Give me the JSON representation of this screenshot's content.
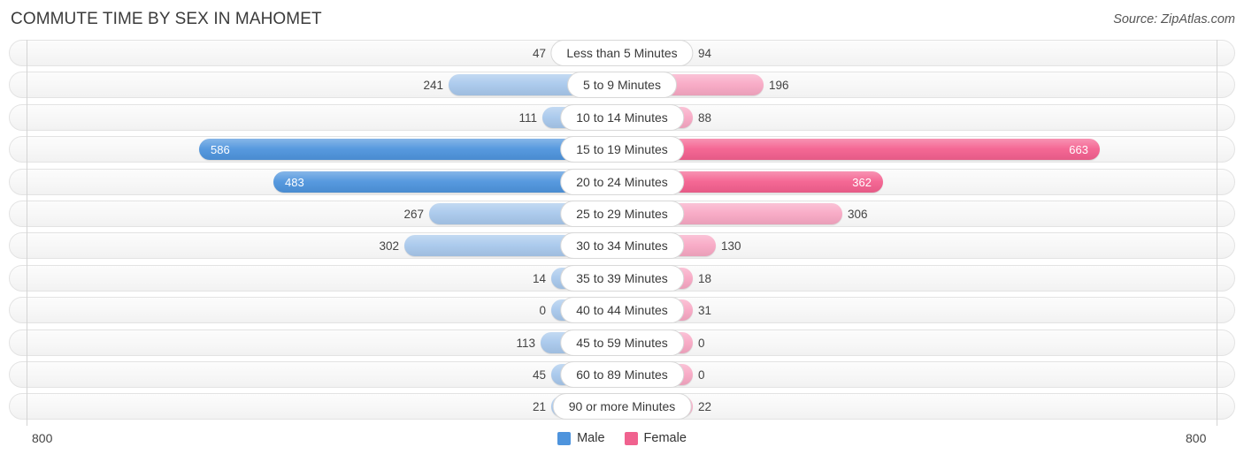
{
  "header": {
    "title": "COMMUTE TIME BY SEX IN MAHOMET",
    "source": "Source: ZipAtlas.com"
  },
  "legend": {
    "items": [
      {
        "label": "Male",
        "color": "#4e94dd"
      },
      {
        "label": "Female",
        "color": "#f0628f"
      }
    ]
  },
  "axis": {
    "left_label": "800",
    "right_label": "800",
    "max": 800
  },
  "colors": {
    "male_strong": "#4e94dd",
    "male_light": "#a8c8ec",
    "female_strong": "#f4608f",
    "female_light": "#f8a8c4",
    "row_track": "#f7f7f7",
    "row_border": "#e3e3e3",
    "gridline": "#d4d4d4"
  },
  "chart_data": {
    "type": "bar",
    "title": "COMMUTE TIME BY SEX IN MAHOMET",
    "subtitle": "Source: ZipAtlas.com",
    "orientation": "horizontal-diverging",
    "xlabel": "",
    "ylabel": "",
    "xlim": [
      800,
      800
    ],
    "grid": true,
    "legend_position": "bottom-center",
    "categories": [
      "Less than 5 Minutes",
      "5 to 9 Minutes",
      "10 to 14 Minutes",
      "15 to 19 Minutes",
      "20 to 24 Minutes",
      "25 to 29 Minutes",
      "30 to 34 Minutes",
      "35 to 39 Minutes",
      "40 to 44 Minutes",
      "45 to 59 Minutes",
      "60 to 89 Minutes",
      "90 or more Minutes"
    ],
    "series": [
      {
        "name": "Male",
        "values": [
          47,
          241,
          111,
          586,
          483,
          267,
          302,
          14,
          0,
          113,
          45,
          21
        ]
      },
      {
        "name": "Female",
        "values": [
          94,
          196,
          88,
          663,
          362,
          306,
          130,
          18,
          31,
          0,
          0,
          22
        ]
      }
    ]
  }
}
